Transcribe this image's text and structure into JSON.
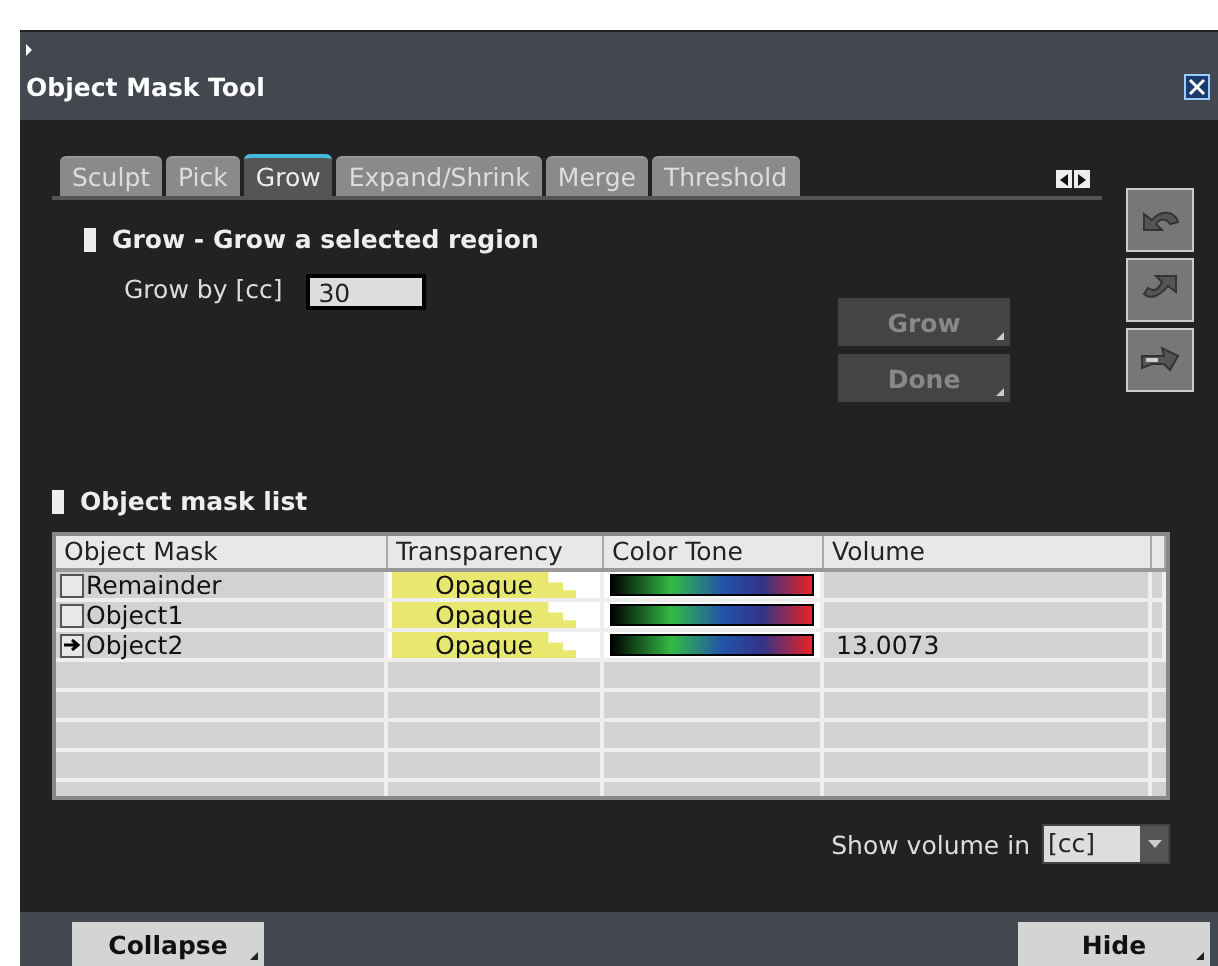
{
  "window": {
    "title": "Object Mask Tool"
  },
  "tabs": [
    {
      "label": "Sculpt",
      "selected": false
    },
    {
      "label": "Pick",
      "selected": false
    },
    {
      "label": "Grow",
      "selected": true
    },
    {
      "label": "Expand/Shrink",
      "selected": false
    },
    {
      "label": "Merge",
      "selected": false
    },
    {
      "label": "Threshold",
      "selected": false
    }
  ],
  "grow_section": {
    "title": "Grow - Grow a selected region",
    "field_label": "Grow by [cc]",
    "field_value": "30",
    "buttons": [
      {
        "label": "Grow",
        "disabled": true
      },
      {
        "label": "Done",
        "disabled": true
      }
    ]
  },
  "mask_list": {
    "title": "Object mask list",
    "columns": [
      "Object Mask",
      "Transparency",
      "Color Tone",
      "Volume"
    ],
    "rows": [
      {
        "name": "Remainder",
        "current": false,
        "transparency": "Opaque",
        "volume": ""
      },
      {
        "name": "Object1",
        "current": false,
        "transparency": "Opaque",
        "volume": ""
      },
      {
        "name": "Object2",
        "current": true,
        "transparency": "Opaque",
        "volume": "13.0073"
      }
    ]
  },
  "volume_unit": {
    "label": "Show volume in",
    "value": "[cc]"
  },
  "footer_buttons": [
    "Collapse",
    "Hide"
  ]
}
